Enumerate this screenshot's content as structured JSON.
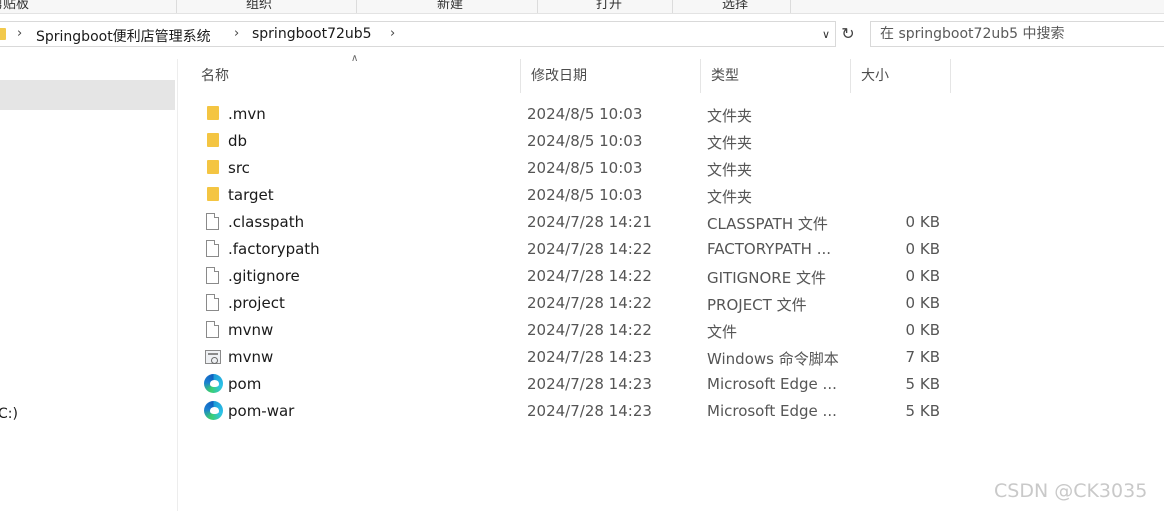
{
  "ribbon": {
    "groups": [
      "剪贴板",
      "组织",
      "新建",
      "打开",
      "选择"
    ]
  },
  "address": {
    "crumbs": [
      "Springboot便利店管理系统",
      "springboot72ub5"
    ]
  },
  "search": {
    "placeholder": "在 springboot72ub5 中搜索"
  },
  "nav": {
    "drive_label": "C:)"
  },
  "columns": {
    "name": "名称",
    "date": "修改日期",
    "type": "类型",
    "size": "大小"
  },
  "files": [
    {
      "name": ".mvn",
      "date": "2024/8/5 10:03",
      "type": "文件夹",
      "size": "",
      "icon": "folder-icon"
    },
    {
      "name": "db",
      "date": "2024/8/5 10:03",
      "type": "文件夹",
      "size": "",
      "icon": "folder-icon"
    },
    {
      "name": "src",
      "date": "2024/8/5 10:03",
      "type": "文件夹",
      "size": "",
      "icon": "folder-icon"
    },
    {
      "name": "target",
      "date": "2024/8/5 10:03",
      "type": "文件夹",
      "size": "",
      "icon": "folder-icon"
    },
    {
      "name": ".classpath",
      "date": "2024/7/28 14:21",
      "type": "CLASSPATH 文件",
      "size": "0 KB",
      "icon": "file-icon"
    },
    {
      "name": ".factorypath",
      "date": "2024/7/28 14:22",
      "type": "FACTORYPATH ...",
      "size": "0 KB",
      "icon": "file-icon"
    },
    {
      "name": ".gitignore",
      "date": "2024/7/28 14:22",
      "type": "GITIGNORE 文件",
      "size": "0 KB",
      "icon": "file-icon"
    },
    {
      "name": ".project",
      "date": "2024/7/28 14:22",
      "type": "PROJECT 文件",
      "size": "0 KB",
      "icon": "file-icon"
    },
    {
      "name": "mvnw",
      "date": "2024/7/28 14:22",
      "type": "文件",
      "size": "0 KB",
      "icon": "file-icon"
    },
    {
      "name": "mvnw",
      "date": "2024/7/28 14:23",
      "type": "Windows 命令脚本",
      "size": "7 KB",
      "icon": "cmd-script-icon"
    },
    {
      "name": "pom",
      "date": "2024/7/28 14:23",
      "type": "Microsoft Edge ...",
      "size": "5 KB",
      "icon": "edge-icon"
    },
    {
      "name": "pom-war",
      "date": "2024/7/28 14:23",
      "type": "Microsoft Edge ...",
      "size": "5 KB",
      "icon": "edge-icon"
    }
  ],
  "watermark": "CSDN @CK3035",
  "colors": {
    "folder": "#f4c542",
    "selection": "#e5e5e5",
    "edge_blue": "#1c9ad6",
    "edge_green": "#3ccf6d"
  }
}
